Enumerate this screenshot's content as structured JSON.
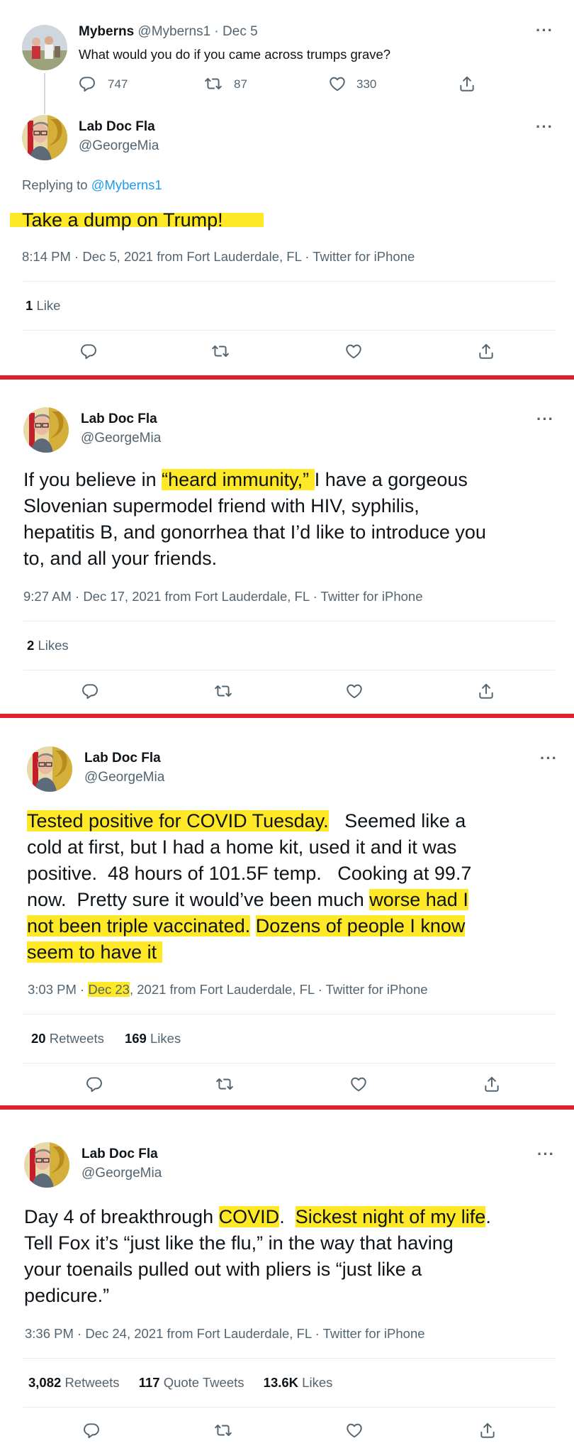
{
  "parent_tweet": {
    "name": "Myberns",
    "handle": "@Myberns1",
    "dot": "·",
    "date": "Dec 5",
    "text": "What would you do if you came across trumps grave?",
    "replies": "747",
    "retweets": "87",
    "likes": "330"
  },
  "tweet1": {
    "name": "Lab Doc Fla",
    "handle": "@GeorgeMia",
    "replying_prefix": "Replying to ",
    "replying_to": "@Myberns1",
    "text": "Take a dump on Trump!",
    "timestamp": "8:14 PM · Dec 5, 2021 from Fort Lauderdale, FL · Twitter for iPhone",
    "likes_count": "1",
    "likes_label": "Like"
  },
  "tweet2": {
    "name": "Lab Doc Fla",
    "handle": "@GeorgeMia",
    "line1_a": "If you believe in ",
    "line1_hl": "“heard immunity,” ",
    "line1_b": "I have a gorgeous",
    "line2": "Slovenian supermodel friend with HIV, syphilis,",
    "line3": "hepatitis B, and gonorrhea that I’d like to introduce you",
    "line4": "to, and all your friends.",
    "timestamp": "9:27 AM · Dec 17, 2021 from Fort Lauderdale, FL · Twitter for iPhone",
    "likes_count": "2",
    "likes_label": "Likes"
  },
  "tweet3": {
    "name": "Lab Doc Fla",
    "handle": "@GeorgeMia",
    "line1_hl": "Tested positive for COVID Tuesday.",
    "line1_b": "   Seemed like a",
    "line2": "cold at first, but I had a home kit, used it and it was",
    "line3": "positive.  48 hours of 101.5F temp.   Cooking at 99.7",
    "line4_a": "now.  Pretty sure it would’ve been much ",
    "line4_hl": "worse had I",
    "line5_hl": "not been triple vaccinated.",
    "line5_b": " ",
    "line5_hl2": "Dozens of people I know",
    "line6_hl": "seem to have it ",
    "time": "3:03 PM · ",
    "date_hl": "Dec 23",
    "meta_rest": ", 2021 from Fort Lauderdale, FL · Twitter for iPhone",
    "retweets_count": "20",
    "retweets_label": "Retweets",
    "likes_count": "169",
    "likes_label": "Likes"
  },
  "tweet4": {
    "name": "Lab Doc Fla",
    "handle": "@GeorgeMia",
    "line1_a": "Day 4 of breakthrough ",
    "line1_hl": "COVID",
    "line1_b": ".  ",
    "line1_hl2": "Sickest night of my life",
    "line1_c": ".",
    "line2": "Tell Fox it’s “just like the flu,” in the way that having",
    "line3": "your toenails pulled out with pliers is “just like a",
    "line4": "pedicure.”",
    "timestamp": "3:36 PM · Dec 24, 2021 from Fort Lauderdale, FL · Twitter for iPhone",
    "retweets_count": "3,082",
    "retweets_label": "Retweets",
    "quotes_count": "117",
    "quotes_label": "Quote Tweets",
    "likes_count": "13.6K",
    "likes_label": "Likes"
  },
  "icons": {
    "reply": "reply-icon",
    "retweet": "retweet-icon",
    "like": "heart-icon",
    "share": "share-icon",
    "more": "more-icon"
  },
  "colors": {
    "highlight": "#ffe927",
    "divider": "#e0202a",
    "link": "#1d9bf0",
    "secondary": "#536471"
  }
}
